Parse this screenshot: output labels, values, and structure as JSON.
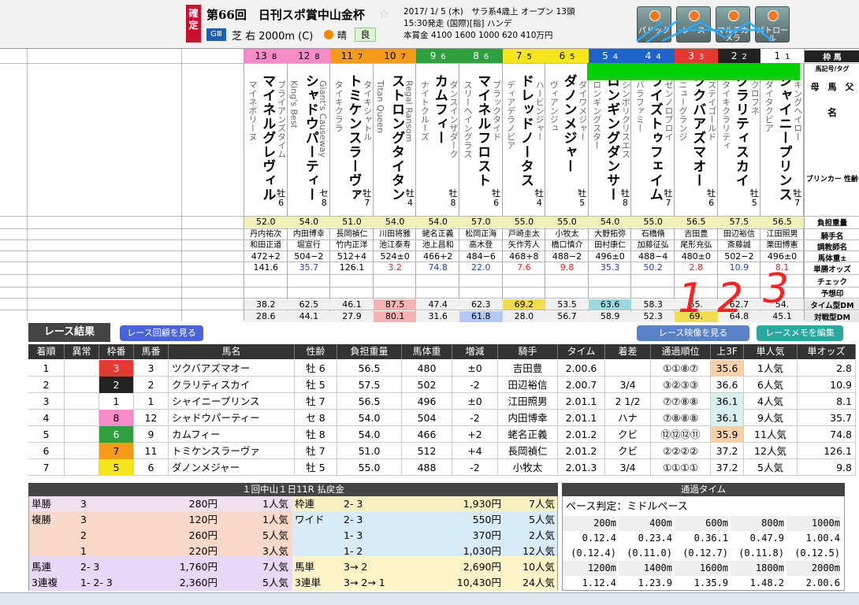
{
  "header": {
    "kakutei": "確定",
    "race_name": "第66回　日刊スポ賞中山金杯",
    "grade": "GⅢ",
    "course": "芝 右 2000m (C)",
    "weather": "晴",
    "going": "良",
    "info1": "2017/ 1/ 5 (木)　サラ系4歳上 オープン 13頭",
    "info2": "15:30発走 (国際)[指] ハンデ",
    "info3": "本賞金 4100 1600 1000 620 410万円",
    "buttons": [
      "パドック",
      "レース",
      "マルチカメラ",
      "パトロール"
    ],
    "star": "☆"
  },
  "row_labels": [
    "枠 馬",
    "馬記号/タグ",
    "母　馬　父",
    "名",
    "ブリンカー 性齢",
    "負担重量",
    "騎手名",
    "調教師名",
    "馬体重±",
    "単勝オッズ",
    "チェック",
    "予想印",
    "タイム型DM",
    "対戦型DM"
  ],
  "horses": [
    {
      "waku": "8",
      "umaban": "13",
      "name": "マイネルグレヴィル",
      "sire": "ブライアンズタイム",
      "dam": "マイネポリーヌ",
      "sex": "牡",
      "age": "6",
      "wt": "52.0",
      "jockey": "丹内祐次",
      "trainer": "和田正道",
      "bw": "472+2",
      "odds": "141.6",
      "dm1": "38.2",
      "dm2": "28.6"
    },
    {
      "waku": "8",
      "umaban": "12",
      "name": "シャドウパーティー",
      "sire": "Giant's Causeway",
      "dam": "King's Best",
      "sex": "セ",
      "age": "8",
      "wt": "54.0",
      "jockey": "内田博幸",
      "trainer": "堀宣行",
      "bw": "504−2",
      "odds": "35.7",
      "dm1": "62.5",
      "dm2": "44.1"
    },
    {
      "waku": "7",
      "umaban": "11",
      "name": "トミケンスラーヴァ",
      "sire": "タイキシャトル",
      "dam": "タイキクララ",
      "sex": "牡",
      "age": "7",
      "wt": "51.0",
      "jockey": "長岡禎仁",
      "trainer": "竹内正洋",
      "bw": "512+4",
      "odds": "126.1",
      "dm1": "46.1",
      "dm2": "27.9"
    },
    {
      "waku": "7",
      "umaban": "10",
      "name": "ストロングタイタン",
      "sire": "Regal Ransom",
      "dam": "Titan Queen",
      "sex": "牡",
      "age": "4",
      "wt": "54.0",
      "jockey": "川田将雅",
      "trainer": "池江泰寿",
      "bw": "524±0",
      "odds": "3.2",
      "dm1": "87.5",
      "dm2": "80.1"
    },
    {
      "waku": "6",
      "umaban": "9",
      "name": "カムフィー",
      "sire": "ダンスインザダーク",
      "dam": "ナイトクルーズ",
      "sex": "牡",
      "age": "8",
      "wt": "54.0",
      "jockey": "蛯名正義",
      "trainer": "池上昌和",
      "bw": "466+2",
      "odds": "74.8",
      "dm1": "47.4",
      "dm2": "31.6"
    },
    {
      "waku": "6",
      "umaban": "8",
      "name": "マイネルフロスト",
      "sire": "ブラックタイド",
      "dam": "スリーヘイングラス",
      "sex": "牡",
      "age": "6",
      "wt": "57.0",
      "jockey": "松岡正海",
      "trainer": "高木登",
      "bw": "484−6",
      "odds": "22.0",
      "dm1": "62.3",
      "dm2": "61.8"
    },
    {
      "waku": "5",
      "umaban": "7",
      "name": "ドレッドノータス",
      "sire": "ハービンジャー",
      "dam": "ディアデラノビア",
      "sex": "牡",
      "age": "4",
      "wt": "55.0",
      "jockey": "戸崎圭太",
      "trainer": "矢作芳人",
      "bw": "468+8",
      "odds": "7.6",
      "dm1": "69.2",
      "dm2": "28.0"
    },
    {
      "waku": "5",
      "umaban": "6",
      "name": "ダノンメジャー",
      "sire": "ダイワメジャー",
      "dam": "ヴィアンジュ",
      "sex": "牡",
      "age": "5",
      "wt": "55.0",
      "jockey": "小牧太",
      "trainer": "橋口慎介",
      "bw": "488−2",
      "odds": "9.8",
      "dm1": "53.5",
      "dm2": "56.7"
    },
    {
      "waku": "4",
      "umaban": "5",
      "name": "ロンギングダンサー",
      "sire": "シンボリクリスエス",
      "dam": "ロンギングスター",
      "sex": "牡",
      "age": "8",
      "wt": "54.0",
      "jockey": "大野拓弥",
      "trainer": "田村康仁",
      "bw": "496±0",
      "odds": "35.3",
      "dm1": "63.6",
      "dm2": "58.9"
    },
    {
      "waku": "4",
      "umaban": "4",
      "name": "ライズトゥフェイム",
      "sire": "ゼンノロブロイ",
      "dam": "バラファミー",
      "sex": "牡",
      "age": "7",
      "wt": "55.0",
      "jockey": "石橋脩",
      "trainer": "加藤征弘",
      "bw": "488−4",
      "odds": "50.2",
      "dm1": "58.3",
      "dm2": "52.3"
    },
    {
      "waku": "3",
      "umaban": "3",
      "name": "ツクバアズマオー",
      "sire": "ステイゴールド",
      "dam": "ニューグランジ",
      "sex": "牡",
      "age": "6",
      "wt": "56.5",
      "jockey": "吉田豊",
      "trainer": "尾形充弘",
      "bw": "480±0",
      "odds": "2.8",
      "dm1": "55.",
      "dm2": "69."
    },
    {
      "waku": "2",
      "umaban": "2",
      "name": "クラリティスカイ",
      "sire": "クロフネ",
      "dam": "タイキクラリティ",
      "sex": "牡",
      "age": "5",
      "wt": "57.5",
      "jockey": "田辺裕信",
      "trainer": "斎藤誠",
      "bw": "502−2",
      "odds": "10.9",
      "dm1": "62.7",
      "dm2": "64.8"
    },
    {
      "waku": "1",
      "umaban": "1",
      "name": "シャイニープリンス",
      "sire": "キングヘイロー",
      "dam": "ダイタクビア",
      "sex": "牡",
      "age": "7",
      "wt": "56.5",
      "jockey": "江田照男",
      "trainer": "栗田博憲",
      "bw": "496±0",
      "odds": "8.1",
      "dm1": "54.",
      "dm2": "45.1"
    }
  ],
  "annotations": {
    "marks": "1 2 3"
  },
  "results": {
    "title": "レース結果",
    "btn_replay": "レース回顧を見る",
    "btn_video": "レース映像を見る",
    "btn_memo": "レースメモを編集",
    "cols": [
      "着順",
      "異常",
      "枠番",
      "馬番",
      "馬名",
      "性齢",
      "負担重量",
      "馬体重",
      "増減",
      "騎手",
      "タイム",
      "着差",
      "通過順位",
      "上3F",
      "単人気",
      "単オッズ"
    ],
    "rows": [
      [
        "1",
        "",
        "3",
        "3",
        "ツクバアズマオー",
        "牡 6",
        "56.5",
        "480",
        "±0",
        "吉田豊",
        "2.00.6",
        "",
        "①①⑧⑦",
        "35.6",
        "1人気",
        "2.8"
      ],
      [
        "2",
        "",
        "2",
        "2",
        "クラリティスカイ",
        "牡 5",
        "57.5",
        "502",
        "-2",
        "田辺裕信",
        "2.00.7",
        "3/4",
        "③②③③",
        "36.6",
        "6人気",
        "10.9"
      ],
      [
        "3",
        "",
        "1",
        "1",
        "シャイニープリンス",
        "牡 7",
        "56.5",
        "496",
        "±0",
        "江田照男",
        "2.01.1",
        "2 1/2",
        "⑦⑦⑧⑧",
        "36.1",
        "4人気",
        "8.1"
      ],
      [
        "4",
        "",
        "8",
        "12",
        "シャドウパーティー",
        "セ 8",
        "54.0",
        "504",
        "-2",
        "内田博幸",
        "2.01.1",
        "ハナ",
        "⑦⑧⑧⑧",
        "36.1",
        "9人気",
        "35.7"
      ],
      [
        "5",
        "",
        "6",
        "9",
        "カムフィー",
        "牡 8",
        "54.0",
        "466",
        "+2",
        "蛯名正義",
        "2.01.2",
        "クビ",
        "⑫⑫⑫⑪",
        "35.9",
        "11人気",
        "74.8"
      ],
      [
        "6",
        "",
        "7",
        "11",
        "トミケンスラーヴァ",
        "牡 7",
        "51.0",
        "512",
        "+4",
        "長岡禎仁",
        "2.01.2",
        "クビ",
        "②②②②",
        "37.2",
        "12人気",
        "126.1"
      ],
      [
        "7",
        "",
        "5",
        "6",
        "ダノンメジャー",
        "牡 5",
        "55.0",
        "488",
        "-2",
        "小牧太",
        "2.01.3",
        "3/4",
        "①①①①",
        "37.2",
        "5人気",
        "9.8"
      ]
    ]
  },
  "payout": {
    "title": "１回中山１日11R 払戻金",
    "left": [
      [
        "単勝",
        "3",
        "280円",
        "1人気"
      ],
      [
        "複勝",
        "3",
        "120円",
        "1人気"
      ],
      [
        "",
        "2",
        "260円",
        "5人気"
      ],
      [
        "",
        "1",
        "220円",
        "3人気"
      ],
      [
        "馬連",
        "2- 3",
        "1,760円",
        "7人気"
      ],
      [
        "3連複",
        "1- 2- 3",
        "2,360円",
        "5人気"
      ]
    ],
    "right": [
      [
        "枠連",
        "2- 3",
        "1,930円",
        "7人気"
      ],
      [
        "ワイド",
        "2- 3",
        "550円",
        "5人気"
      ],
      [
        "",
        "1- 3",
        "370円",
        "2人気"
      ],
      [
        "",
        "1- 2",
        "1,030円",
        "12人気"
      ],
      [
        "馬単",
        "3→ 2",
        "2,690円",
        "10人気"
      ],
      [
        "3連単",
        "3→ 2→ 1",
        "10,430円",
        "24人気"
      ]
    ]
  },
  "times": {
    "title": "通過タイム",
    "pace": "ペース判定：ミドルペース",
    "h1": [
      "200m",
      "400m",
      "600m",
      "800m",
      "1000m"
    ],
    "r1": [
      "0.12.4",
      "0.23.4",
      "0.36.1",
      "0.47.9",
      "1.00.4"
    ],
    "r2": [
      "(0.12.4)",
      "(0.11.0)",
      "(0.12.7)",
      "(0.11.8)",
      "(0.12.5)"
    ],
    "h2": [
      "1200m",
      "1400m",
      "1600m",
      "1800m",
      "2000m"
    ],
    "r3": [
      "1.12.4",
      "1.23.9",
      "1.35.9",
      "1.48.2",
      "2.00.6"
    ]
  },
  "colors": {
    "waku": {
      "1": "#ffffff",
      "2": "#222222",
      "3": "#e53935",
      "4": "#1e63c8",
      "5": "#f5e51b",
      "6": "#2e9e3e",
      "7": "#f59b1b",
      "8": "#f58cc8"
    }
  }
}
